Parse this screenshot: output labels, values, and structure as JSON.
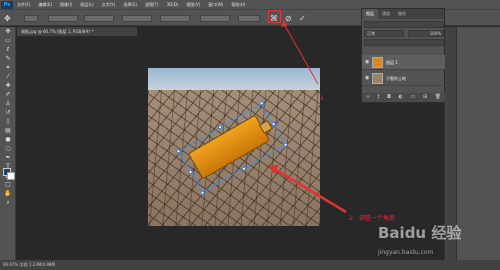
{
  "menubar": {
    "logo": "Ps",
    "items": [
      "文件(F)",
      "编辑(E)",
      "图像(I)",
      "图层(L)",
      "文字(Y)",
      "选择(S)",
      "滤镜(T)",
      "3D(D)",
      "视图(V)",
      "窗口(W)",
      "帮助(H)"
    ]
  },
  "document": {
    "tab_title": "调瓶.jpg @ 66.7% (图层 1, RGB/8#) *"
  },
  "layers_panel": {
    "tabs": [
      "图层",
      "通道",
      "路径"
    ],
    "filter_label": "正常",
    "opacity_label": "100%",
    "layers": [
      {
        "name": "图层 1",
        "selected": true
      },
      {
        "name": "干裂的土地",
        "selected": false
      }
    ]
  },
  "status": {
    "text": "66.67%     文档:1.23M/4.98M"
  },
  "annotations": {
    "label1": "1",
    "label2": "2、调整一个角度"
  },
  "watermark": {
    "logo": "Baidu 经验",
    "url": "jingyan.baidu.com"
  },
  "colors": {
    "annotation": "#e23333",
    "bbox": "#4a8bd6",
    "bottle": "#f0a21f"
  }
}
